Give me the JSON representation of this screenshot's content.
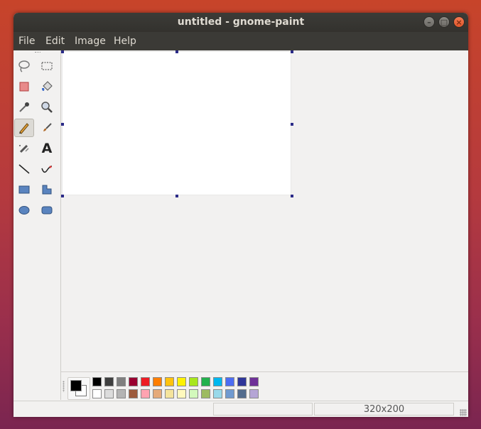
{
  "window": {
    "title": "untitled - gnome-paint"
  },
  "menu": [
    "File",
    "Edit",
    "Image",
    "Help"
  ],
  "tools": [
    {
      "name": "lasso-select-icon"
    },
    {
      "name": "rectangle-select-icon"
    },
    {
      "name": "eraser-icon"
    },
    {
      "name": "paint-bucket-icon"
    },
    {
      "name": "eyedropper-icon"
    },
    {
      "name": "magnifier-icon"
    },
    {
      "name": "pencil-icon",
      "active": true
    },
    {
      "name": "paintbrush-icon"
    },
    {
      "name": "airbrush-icon"
    },
    {
      "name": "text-icon",
      "label": "A"
    },
    {
      "name": "line-icon"
    },
    {
      "name": "curve-icon"
    },
    {
      "name": "rectangle-icon"
    },
    {
      "name": "polygon-icon"
    },
    {
      "name": "ellipse-icon"
    },
    {
      "name": "rounded-rectangle-icon"
    }
  ],
  "colors": {
    "foreground": "#000000",
    "background": "#ffffff",
    "row1": [
      "#000000",
      "#3f3f3f",
      "#7f7f7f",
      "#990030",
      "#ed1c24",
      "#ff7e00",
      "#ffc20e",
      "#fff200",
      "#a8e61d",
      "#22b14c",
      "#00b7ef",
      "#4d6df3",
      "#2f3699",
      "#6f3198"
    ],
    "row2": [
      "#ffffff",
      "#dcdcdc",
      "#b4b4b4",
      "#9c5a3c",
      "#ffa3b1",
      "#e5aa7a",
      "#f5e49c",
      "#fff9bd",
      "#d3f9bc",
      "#9dbb61",
      "#99d9ea",
      "#709ad1",
      "#546d8e",
      "#b5a5d5"
    ]
  },
  "status": {
    "size": "320x200"
  }
}
